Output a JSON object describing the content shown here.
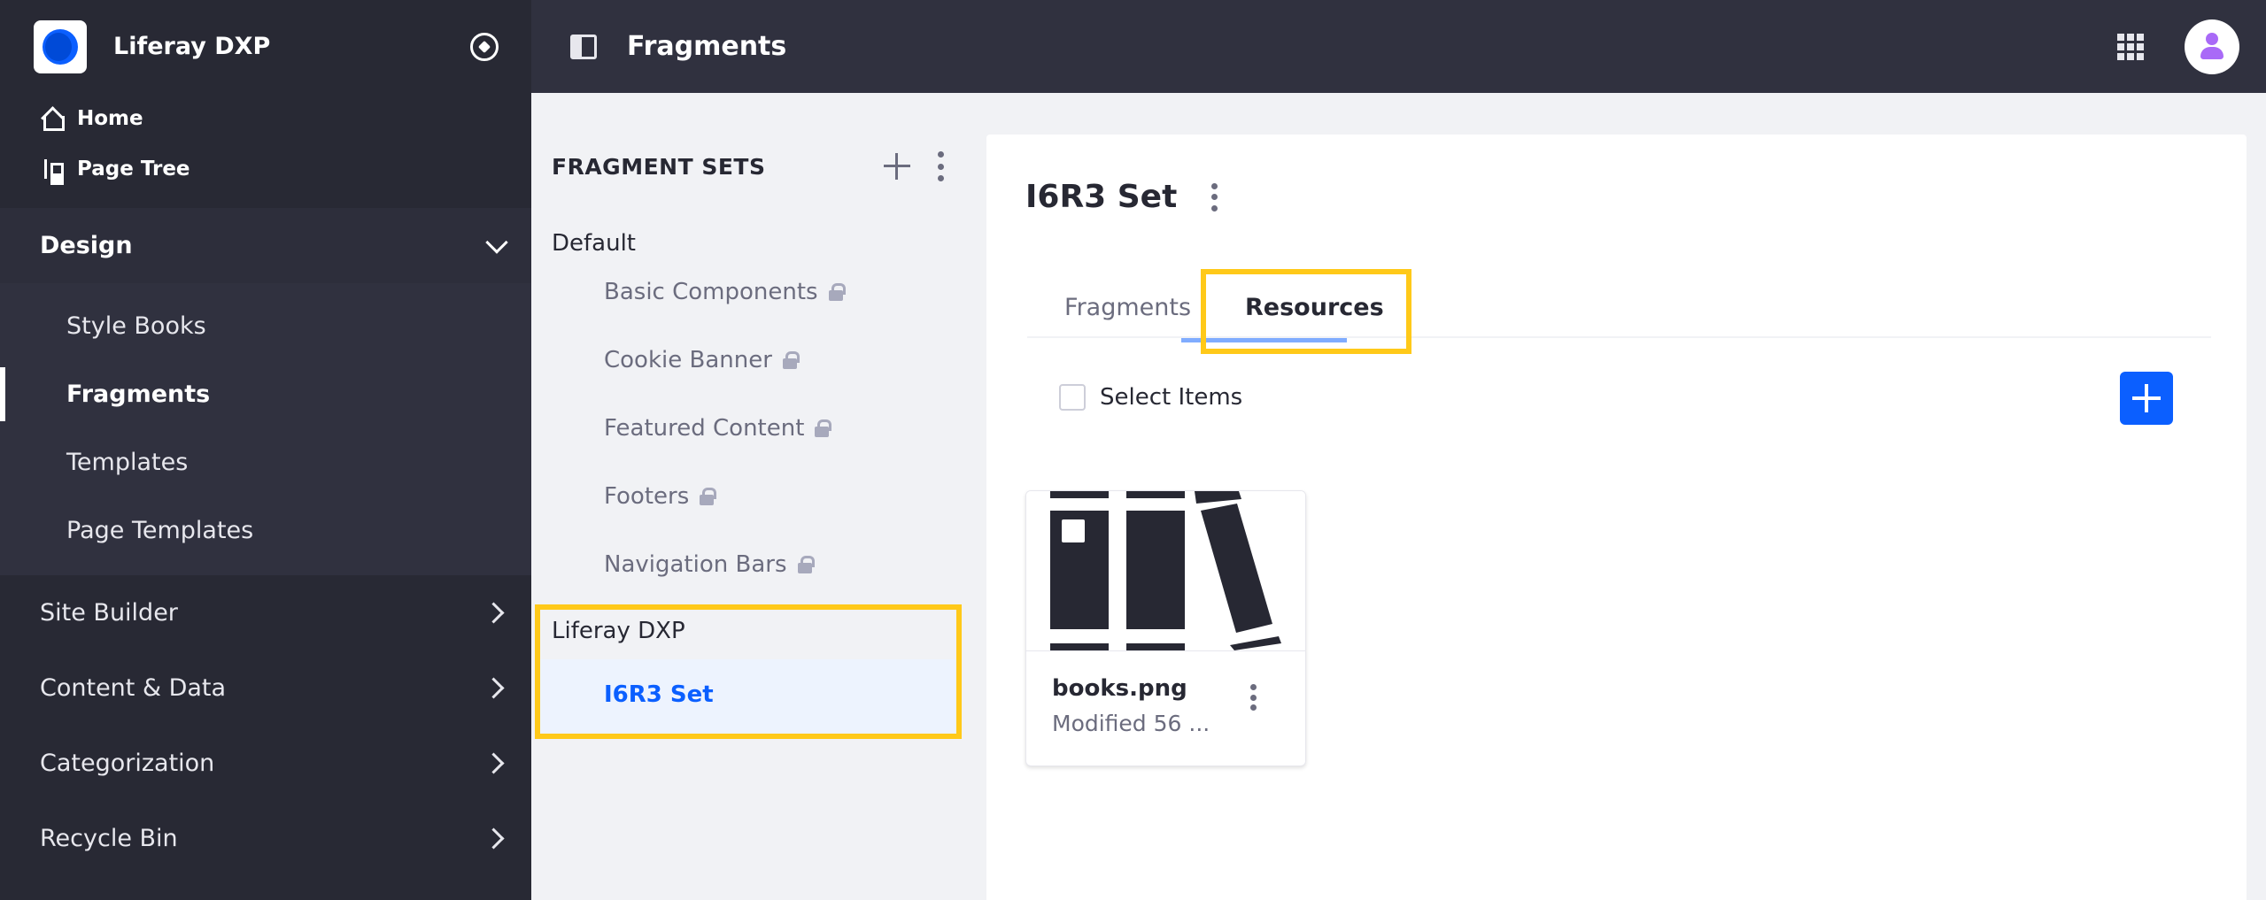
{
  "sidebar": {
    "product_name": "Liferay DXP",
    "top_links": [
      {
        "label": "Home",
        "icon": "home-icon"
      },
      {
        "label": "Page Tree",
        "icon": "page-tree-icon"
      }
    ],
    "design": {
      "label": "Design",
      "expanded": true,
      "items": [
        {
          "label": "Style Books",
          "active": false
        },
        {
          "label": "Fragments",
          "active": true
        },
        {
          "label": "Templates",
          "active": false
        },
        {
          "label": "Page Templates",
          "active": false
        }
      ]
    },
    "sections": [
      {
        "label": "Site Builder"
      },
      {
        "label": "Content & Data"
      },
      {
        "label": "Categorization"
      },
      {
        "label": "Recycle Bin"
      }
    ]
  },
  "topbar": {
    "title": "Fragments"
  },
  "fragment_sets": {
    "header": "FRAGMENT SETS",
    "groups": [
      {
        "label": "Default",
        "items": [
          "Basic Components",
          "Cookie Banner",
          "Featured Content",
          "Footers",
          "Navigation Bars"
        ]
      },
      {
        "label": "Liferay DXP",
        "items": [
          "I6R3 Set"
        ]
      }
    ],
    "selected": "I6R3 Set"
  },
  "main": {
    "set_title": "I6R3 Set",
    "tabs": [
      {
        "label": "Fragments",
        "active": false
      },
      {
        "label": "Resources",
        "active": true
      }
    ],
    "select_items_label": "Select Items",
    "resources": [
      {
        "name": "books.png",
        "meta": "Modified 56 ..."
      }
    ]
  },
  "colors": {
    "accent": "#0b5fff",
    "highlight": "#ffc919",
    "sidebar_bg": "#282934"
  }
}
